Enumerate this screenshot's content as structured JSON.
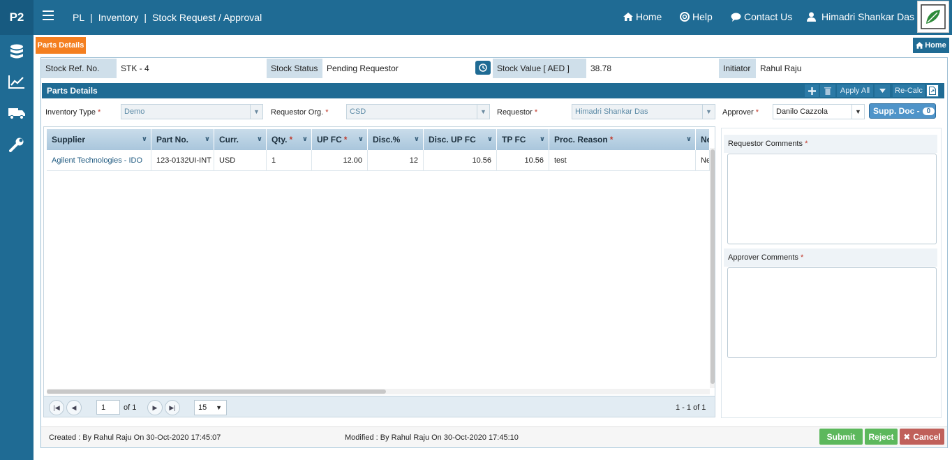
{
  "topbar": {
    "logo": "P2",
    "breadcrumb": [
      "PL",
      "Inventory",
      "Stock Request / Approval"
    ],
    "nav": {
      "home": "Home",
      "help": "Help",
      "contact": "Contact Us",
      "user": "Himadri Shankar Das"
    }
  },
  "tabs": {
    "active": "Parts Details",
    "home_button": "Home"
  },
  "info": {
    "stock_ref_label": "Stock Ref. No.",
    "stock_ref_value": "STK - 4",
    "status_label": "Stock Status",
    "status_value": "Pending Requestor",
    "value_label": "Stock Value [ AED ]",
    "value_value": "38.78",
    "initiator_label": "Initiator",
    "initiator_value": "Rahul Raju"
  },
  "section": {
    "title": "Parts Details",
    "apply_all": "Apply All",
    "recalc": "Re-Calc"
  },
  "filters": {
    "inventory_type_label": "Inventory Type",
    "inventory_type_value": "Demo",
    "requestor_org_label": "Requestor Org.",
    "requestor_org_value": "CSD",
    "requestor_label": "Requestor",
    "requestor_value": "Himadri Shankar Das",
    "approver_label": "Approver",
    "approver_value": "Danilo Cazzola",
    "supp_doc_label": "Supp. Doc -",
    "supp_doc_count": "0"
  },
  "grid": {
    "columns": [
      "Supplier",
      "Part No.",
      "Curr.",
      "Qty.",
      "UP FC",
      "Disc.%",
      "Disc. UP FC",
      "TP FC",
      "Proc. Reason",
      "Ne"
    ],
    "required": [
      false,
      false,
      false,
      true,
      true,
      false,
      false,
      false,
      true,
      false
    ],
    "rows": [
      [
        "Agilent Technologies - IDO",
        "123-0132UI-INT",
        "USD",
        "1",
        "12.00",
        "12",
        "10.56",
        "10.56",
        "test",
        "Ne"
      ]
    ]
  },
  "pager": {
    "page": "1",
    "of_text": "of 1",
    "page_size": "15",
    "summary": "1 - 1 of 1"
  },
  "comments": {
    "requestor_label": "Requestor Comments",
    "approver_label": "Approver Comments"
  },
  "footer": {
    "created": "Created : By Rahul Raju On 30-Oct-2020 17:45:07",
    "modified": "Modified : By Rahul Raju On 30-Oct-2020 17:45:10",
    "submit": "Submit",
    "reject": "Reject",
    "cancel": "Cancel"
  },
  "colors": {
    "primary": "#1f6b94",
    "accent_orange": "#f47f20",
    "submit_green": "#5cb85c",
    "cancel_red": "#c0605a"
  }
}
